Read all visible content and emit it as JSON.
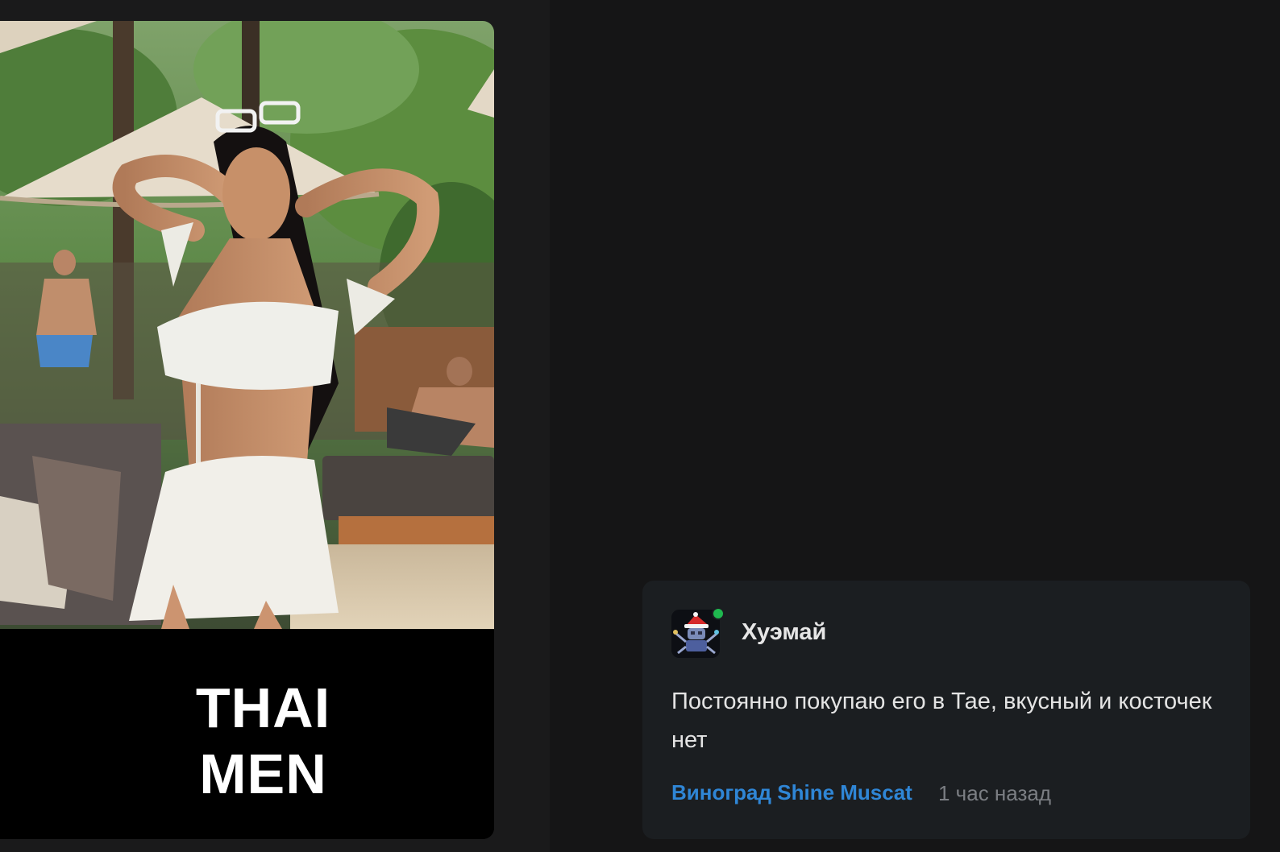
{
  "post": {
    "caption_line1": "THAI",
    "caption_line2": "MEN"
  },
  "comment": {
    "username": "Хуэмай",
    "online": true,
    "text": "Постоянно покупаю его в Тае, вкусный и косточек нет",
    "product_link": "Виноград Shine Muscat",
    "timestamp": "1 час назад"
  },
  "colors": {
    "page_background": "#151516",
    "comment_background": "#1b1e21",
    "link": "#2f86d6",
    "online": "#1fb84f",
    "muted_text": "#7b7e83"
  }
}
